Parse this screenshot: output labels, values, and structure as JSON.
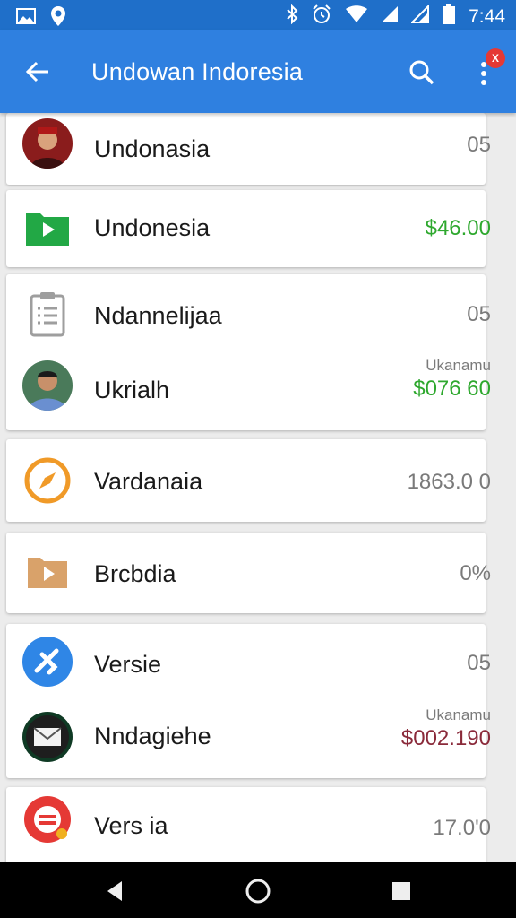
{
  "status_bar": {
    "time": "7:44"
  },
  "app_bar": {
    "title": "Undowan Indoresia",
    "badge": "X"
  },
  "items": [
    {
      "label": "Undonasia",
      "value": "05"
    },
    {
      "label": "Undonesia",
      "value": "$46.00"
    },
    {
      "label": "Ndannelijaa",
      "value": "05"
    },
    {
      "label": "Ukrialh",
      "sub": "Ukanamu",
      "value": "$076 60"
    },
    {
      "label": "Vardanaia",
      "value": "1863.0 0"
    },
    {
      "label": "Brcbdia",
      "value": "0%"
    },
    {
      "label": "Versie",
      "value": "05"
    },
    {
      "label": "Nndagiehe",
      "sub": "Ukanamu",
      "value": "$002.190"
    },
    {
      "label": "Vers ia",
      "value": "17.0'0"
    }
  ],
  "colors": {
    "app_bar": "#2f80e0",
    "status_bar": "#1f6fc9",
    "positive": "#2ea82e",
    "negative": "#8a2a3a"
  }
}
